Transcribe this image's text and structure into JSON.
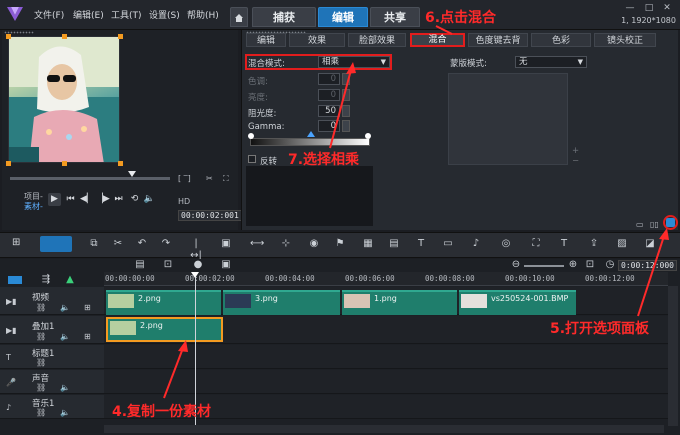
{
  "menu": {
    "items": [
      "文件(F)",
      "编辑(E)",
      "工具(T)",
      "设置(S)",
      "帮助(H)"
    ],
    "tabs": [
      "捕获",
      "编辑",
      "共享"
    ],
    "active_tab": "编辑",
    "resolution": "1, 1920*1080"
  },
  "annotations": {
    "step6": "6.点击混合",
    "step7": "7.选择相乘",
    "step5": "5.打开选项面板",
    "step4": "4.复制一份素材"
  },
  "preview": {
    "project_label": "项目-",
    "clip_label": "素材-",
    "timecode": "00:00:02:001"
  },
  "options": {
    "tabs": [
      "编辑",
      "效果",
      "脸部效果",
      "混合",
      "色度键去背",
      "色彩",
      "镜头校正"
    ],
    "active_tab": "混合",
    "blend_mode_label": "混合模式:",
    "blend_mode_value": "相乘",
    "hue_label": "色调:",
    "hue_value": "0",
    "saturation_label": "亮度:",
    "saturation_value": "0",
    "opacity_label": "阻光度:",
    "opacity_value": "50",
    "gamma_label": "Gamma:",
    "gamma_value": "0",
    "invert_label": "反转",
    "mask_mode_label": "蒙版模式:",
    "mask_mode_value": "无"
  },
  "timeline": {
    "ruler": [
      "00:00:00:00",
      "00:00:02:00",
      "00:00:04:00",
      "00:00:06:00",
      "00:00:08:00",
      "00:00:10:00",
      "00:00:12:00"
    ],
    "zoom_timecode": "0:00:12:000",
    "tracks": [
      {
        "name": "视频",
        "clips": [
          "2.png",
          "3.png",
          "1.png",
          "vs250524-001.BMP"
        ]
      },
      {
        "name": "叠加1",
        "clips": [
          "2.png"
        ]
      },
      {
        "name": "标题1",
        "clips": []
      },
      {
        "name": "声音",
        "clips": []
      },
      {
        "name": "音乐1",
        "clips": []
      }
    ]
  }
}
